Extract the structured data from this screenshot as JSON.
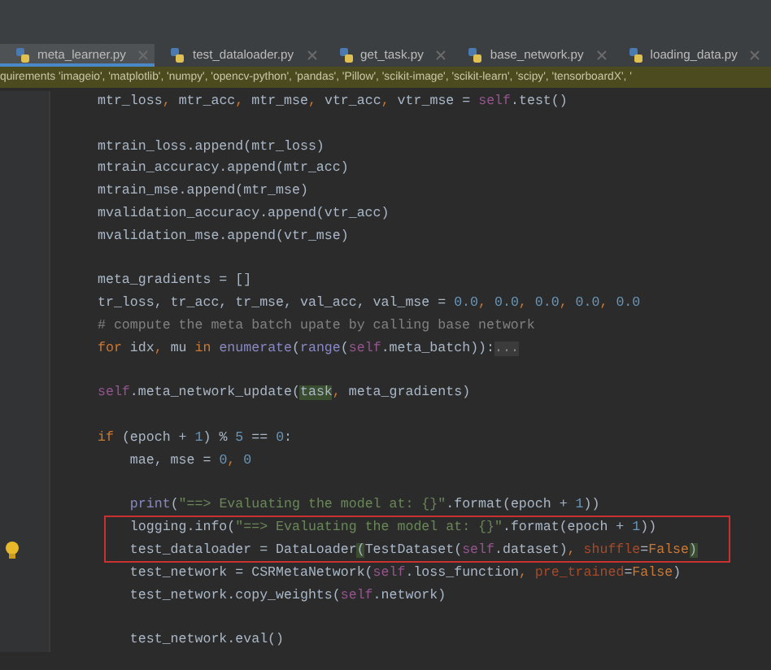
{
  "tabs": [
    {
      "label": "meta_learner.py",
      "selected": true
    },
    {
      "label": "test_dataloader.py",
      "selected": false
    },
    {
      "label": "get_task.py",
      "selected": false
    },
    {
      "label": "base_network.py",
      "selected": false
    },
    {
      "label": "loading_data.py",
      "selected": false
    }
  ],
  "banner": {
    "text": "quirements 'imageio', 'matplotlib', 'numpy', 'opencv-python', 'pandas', 'Pillow', 'scikit-image', 'scikit-learn', 'scipy', 'tensorboardX', '"
  },
  "code_lines": [
    {
      "tokens": [
        {
          "kind": "plain",
          "text": "mtr_loss"
        },
        {
          "kind": "kw",
          "text": ", "
        },
        {
          "kind": "plain",
          "text": "mtr_acc"
        },
        {
          "kind": "kw",
          "text": ", "
        },
        {
          "kind": "plain",
          "text": "mtr_mse"
        },
        {
          "kind": "kw",
          "text": ", "
        },
        {
          "kind": "plain",
          "text": "vtr_acc"
        },
        {
          "kind": "kw",
          "text": ", "
        },
        {
          "kind": "plain",
          "text": "vtr_mse = "
        },
        {
          "kind": "self",
          "text": "self"
        },
        {
          "kind": "plain",
          "text": ".test()"
        }
      ]
    },
    {
      "blank_line_before": true,
      "tokens": [
        {
          "kind": "plain",
          "text": "mtrain_loss.append(mtr_loss)"
        }
      ]
    },
    {
      "tokens": [
        {
          "kind": "plain",
          "text": "mtrain_accuracy.append(mtr_acc)"
        }
      ]
    },
    {
      "tokens": [
        {
          "kind": "plain",
          "text": "mtrain_mse.append(mtr_mse)"
        }
      ]
    },
    {
      "tokens": [
        {
          "kind": "plain",
          "text": "mvalidation_accuracy.append(vtr_acc)"
        }
      ]
    },
    {
      "tokens": [
        {
          "kind": "plain",
          "text": "mvalidation_mse.append(vtr_mse)"
        }
      ]
    },
    {
      "blank_line_before": true,
      "tokens": [
        {
          "kind": "plain",
          "text": "meta_gradients = []"
        }
      ]
    },
    {
      "tokens": [
        {
          "kind": "plain",
          "text": "tr_loss, tr_acc, tr_mse, val_acc, val_mse = "
        },
        {
          "kind": "num",
          "text": "0.0"
        },
        {
          "kind": "kw",
          "text": ", "
        },
        {
          "kind": "num",
          "text": "0.0"
        },
        {
          "kind": "kw",
          "text": ", "
        },
        {
          "kind": "num",
          "text": "0.0"
        },
        {
          "kind": "kw",
          "text": ", "
        },
        {
          "kind": "num",
          "text": "0.0"
        },
        {
          "kind": "kw",
          "text": ", "
        },
        {
          "kind": "num",
          "text": "0.0"
        }
      ]
    },
    {
      "tokens": [
        {
          "kind": "comment",
          "text": "# compute the meta batch upate by calling base network"
        }
      ]
    },
    {
      "tokens": [
        {
          "kind": "kw",
          "text": "for "
        },
        {
          "kind": "plain",
          "text": "idx"
        },
        {
          "kind": "kw",
          "text": ", "
        },
        {
          "kind": "plain",
          "text": "mu "
        },
        {
          "kind": "kw",
          "text": "in "
        },
        {
          "kind": "builtin",
          "text": "enumerate"
        },
        {
          "kind": "plain",
          "text": "("
        },
        {
          "kind": "builtin",
          "text": "range"
        },
        {
          "kind": "plain",
          "text": "("
        },
        {
          "kind": "self",
          "text": "self"
        },
        {
          "kind": "plain",
          "text": ".meta_batch)):"
        },
        {
          "kind": "fold",
          "text": "..."
        }
      ]
    },
    {
      "blank_line_before": true,
      "tokens": [
        {
          "kind": "self",
          "text": "self"
        },
        {
          "kind": "plain",
          "text": ".meta_network_update("
        },
        {
          "kind": "match",
          "text": "task"
        },
        {
          "kind": "kw",
          "text": ", "
        },
        {
          "kind": "plain",
          "text": "meta_gradients)"
        }
      ]
    },
    {
      "blank_line_before": true,
      "tokens": [
        {
          "kind": "kw",
          "text": "if "
        },
        {
          "kind": "plain",
          "text": "(epoch + "
        },
        {
          "kind": "num",
          "text": "1"
        },
        {
          "kind": "plain",
          "text": ") % "
        },
        {
          "kind": "num",
          "text": "5"
        },
        {
          "kind": "plain",
          "text": " == "
        },
        {
          "kind": "num",
          "text": "0"
        },
        {
          "kind": "plain",
          "text": ":"
        }
      ]
    },
    {
      "tokens": [
        {
          "kind": "plain",
          "text": "    mae, mse = "
        },
        {
          "kind": "num",
          "text": "0"
        },
        {
          "kind": "kw",
          "text": ", "
        },
        {
          "kind": "num",
          "text": "0"
        }
      ]
    },
    {
      "blank_line_before": true,
      "tokens": [
        {
          "kind": "builtin",
          "text": "    print"
        },
        {
          "kind": "plain",
          "text": "("
        },
        {
          "kind": "str",
          "text": "\"==> Evaluating the model at: {}\""
        },
        {
          "kind": "plain",
          "text": ".format(epoch + "
        },
        {
          "kind": "num",
          "text": "1"
        },
        {
          "kind": "plain",
          "text": "))"
        }
      ]
    },
    {
      "tokens": [
        {
          "kind": "plain",
          "text": "    logging.info("
        },
        {
          "kind": "str",
          "text": "\"==> Evaluating the model at: {}\""
        },
        {
          "kind": "plain",
          "text": ".format(epoch + "
        },
        {
          "kind": "num",
          "text": "1"
        },
        {
          "kind": "plain",
          "text": "))"
        }
      ]
    },
    {
      "tokens": [
        {
          "kind": "plain",
          "text": "    test_dataloader = DataLoader"
        },
        {
          "kind": "match",
          "text": "("
        },
        {
          "kind": "plain",
          "text": "TestDataset("
        },
        {
          "kind": "self",
          "text": "self"
        },
        {
          "kind": "plain",
          "text": ".dataset)"
        },
        {
          "kind": "kw",
          "text": ", "
        },
        {
          "kind": "param",
          "text": "shuffle"
        },
        {
          "kind": "plain",
          "text": "="
        },
        {
          "kind": "kw",
          "text": "False"
        },
        {
          "kind": "match",
          "text": ")"
        }
      ]
    },
    {
      "tokens": [
        {
          "kind": "plain",
          "text": "    test_network = CSRMetaNetwork("
        },
        {
          "kind": "self",
          "text": "self"
        },
        {
          "kind": "plain",
          "text": ".loss_function"
        },
        {
          "kind": "kw",
          "text": ", "
        },
        {
          "kind": "param",
          "text": "pre_trained"
        },
        {
          "kind": "plain",
          "text": "="
        },
        {
          "kind": "kw",
          "text": "False"
        },
        {
          "kind": "plain",
          "text": ")"
        }
      ]
    },
    {
      "tokens": [
        {
          "kind": "plain",
          "text": "    test_network.copy_weights("
        },
        {
          "kind": "self",
          "text": "self"
        },
        {
          "kind": "plain",
          "text": ".network)"
        }
      ]
    },
    {
      "blank_line_before": true,
      "tokens": [
        {
          "kind": "plain",
          "text": "    test_network.eval()"
        }
      ]
    }
  ]
}
